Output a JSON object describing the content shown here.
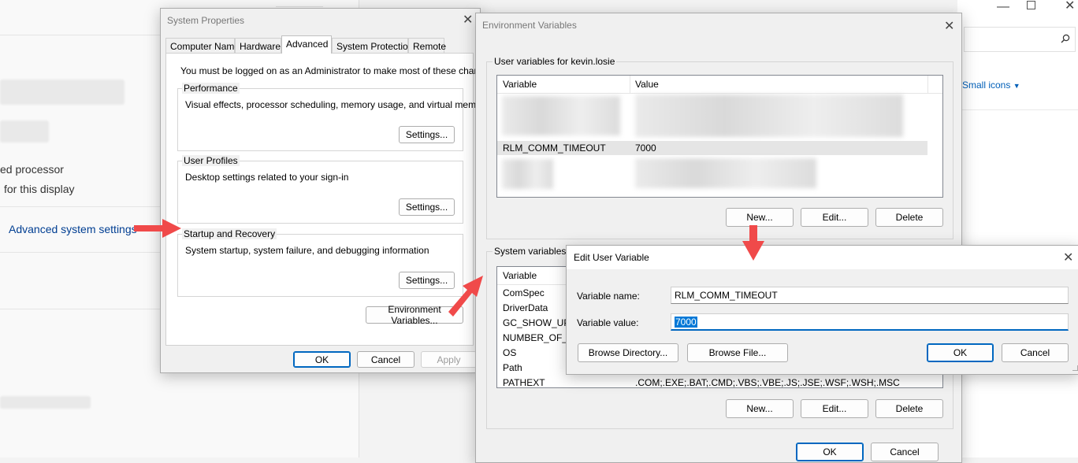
{
  "background_settings": {
    "text_processor": "ed processor",
    "text_display": "for this display",
    "advanced_link": "Advanced system settings"
  },
  "explorer": {
    "view_option": "Small icons",
    "search_icon": "search-icon",
    "dropdown_icon": "chevron-down-icon"
  },
  "system_properties": {
    "title": "System Properties",
    "tabs": [
      "Computer Name",
      "Hardware",
      "Advanced",
      "System Protection",
      "Remote"
    ],
    "active_tab": "Advanced",
    "admin_notice": "You must be logged on as an Administrator to make most of these changes.",
    "performance": {
      "label": "Performance",
      "description": "Visual effects, processor scheduling, memory usage, and virtual memory",
      "button": "Settings..."
    },
    "user_profiles": {
      "label": "User Profiles",
      "description": "Desktop settings related to your sign-in",
      "button": "Settings..."
    },
    "startup_recovery": {
      "label": "Startup and Recovery",
      "description": "System startup, system failure, and debugging information",
      "button": "Settings..."
    },
    "env_button": "Environment Variables...",
    "ok": "OK",
    "cancel": "Cancel",
    "apply": "Apply"
  },
  "environment_variables": {
    "title": "Environment Variables",
    "user_section_label": "User variables for kevin.losie",
    "columns": [
      "Variable",
      "Value"
    ],
    "user_rows": [
      {
        "variable": "RLM_COMM_TIMEOUT",
        "value": "7000"
      }
    ],
    "system_section_label": "System variables",
    "system_rows": [
      {
        "variable": "ComSpec",
        "value": ""
      },
      {
        "variable": "DriverData",
        "value": ""
      },
      {
        "variable": "GC_SHOW_UPD",
        "value": ""
      },
      {
        "variable": "NUMBER_OF_PI",
        "value": ""
      },
      {
        "variable": "OS",
        "value": ""
      },
      {
        "variable": "Path",
        "value": ""
      },
      {
        "variable": "PATHEXT",
        "value": ".COM;.EXE;.BAT;.CMD;.VBS;.VBE;.JS;.JSE;.WSF;.WSH;.MSC"
      }
    ],
    "user_buttons": {
      "new": "New...",
      "edit": "Edit...",
      "delete": "Delete"
    },
    "system_buttons": {
      "new": "New...",
      "edit": "Edit...",
      "delete": "Delete"
    },
    "ok": "OK",
    "cancel": "Cancel"
  },
  "edit_user_variable": {
    "title": "Edit User Variable",
    "name_label": "Variable name:",
    "name_value": "RLM_COMM_TIMEOUT",
    "value_label": "Variable value:",
    "value_value": "7000",
    "browse_directory": "Browse Directory...",
    "browse_file": "Browse File...",
    "ok": "OK",
    "cancel": "Cancel"
  },
  "annotation_color": "#f04a4a"
}
